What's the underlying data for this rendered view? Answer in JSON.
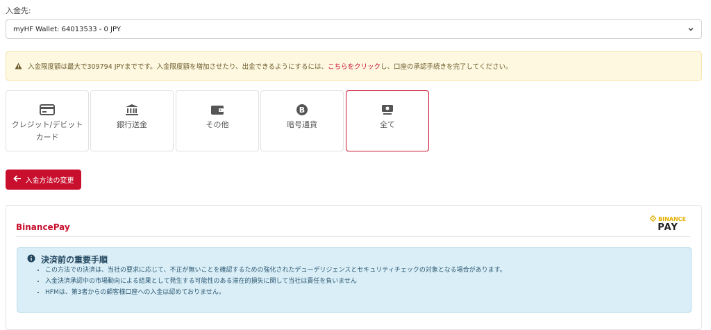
{
  "deposit_to_label": "入金先:",
  "wallet_select": {
    "value": "myHF Wallet: 64013533 - 0 JPY"
  },
  "warning": {
    "text_before": "入金限度額は最大で309794 JPYまでです。入金限度額を増加させたり、出金できるようにするには、",
    "link": "こちらをクリック",
    "text_after": "し、口座の承認手続きを完了してください。"
  },
  "methods": [
    {
      "label": "クレジット/デビットカード",
      "icon": "credit-card-icon"
    },
    {
      "label": "銀行送金",
      "icon": "bank-icon"
    },
    {
      "label": "その他",
      "icon": "wallet-icon"
    },
    {
      "label": "暗号通貨",
      "icon": "bitcoin-icon"
    },
    {
      "label": "全て",
      "icon": "money-icon",
      "selected": true
    }
  ],
  "back_button": {
    "label": "入金方法の変更"
  },
  "panel": {
    "title": "BinancePay",
    "logo": {
      "top": "BINANCE",
      "bottom": "PAY"
    },
    "info": {
      "heading": "決済前の重要手順",
      "items": [
        "この方法での決済は、当社の要求に応じて、不正が無いことを確認するための強化されたデューデリジェンスとセキュリティチェックの対象となる場合があります。",
        "入金決済承認中の市場動向による結果として発生する可能性のある滞在的損失に関して当社は責任を負いません",
        "HFMは、第3者からの顧客様口座への入金は認めておりません。"
      ]
    }
  },
  "colors": {
    "accent": "#c8102e",
    "warning_bg": "#fff8e1",
    "info_bg": "#d9eef7"
  }
}
